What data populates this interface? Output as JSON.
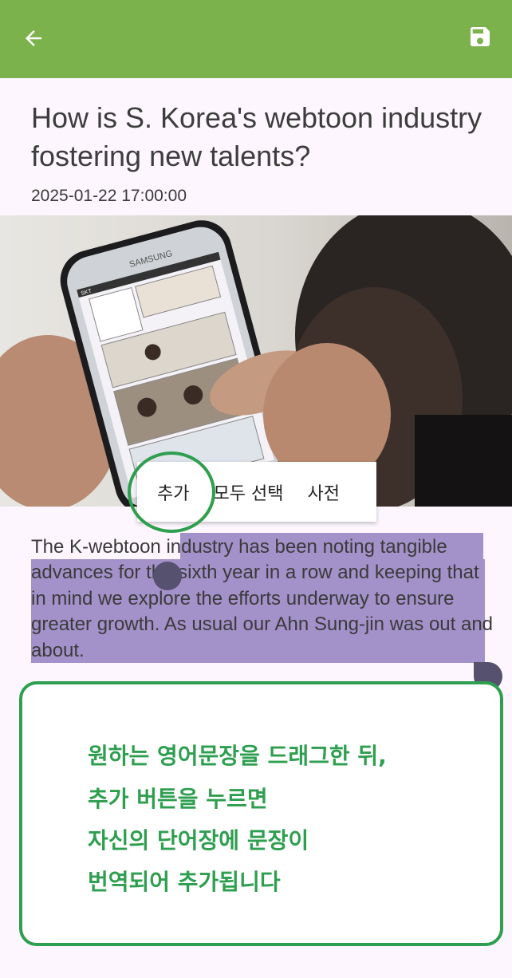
{
  "app_bar": {
    "back_icon": "arrow-back-icon",
    "save_icon": "floppy-disk-icon",
    "color": "#7cb24b"
  },
  "article": {
    "title": "How is S. Korea's webtoon industry fostering new talents?",
    "date": "2025-01-22 17:00:00",
    "image": {
      "phone_brand": "SAMSUNG",
      "status_carrier": "SKT"
    },
    "paragraph_unselected": "The K-webtoon ",
    "paragraph_selected": "industry has been noting tangible advances for the sixth year in a row and keeping that in mind we explore the efforts underway to ensure greater growth. As usual our Ahn Sung-jin  was out and about."
  },
  "context_menu": {
    "items": [
      {
        "label": "추가"
      },
      {
        "label": "모두 선택"
      },
      {
        "label": "사전"
      }
    ]
  },
  "annotation": {
    "lines": [
      "원하는 영어문장을 드래그한 뒤,",
      "추가 버튼을 누르면",
      "자신의 단어장에 문장이",
      "번역되어 추가됩니다"
    ],
    "color": "#2e9e4f"
  },
  "selection_color": "#a391c9"
}
